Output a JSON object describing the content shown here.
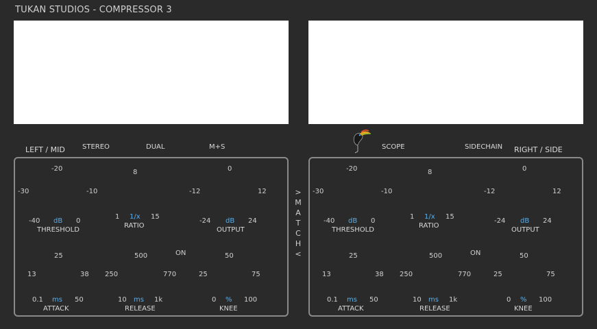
{
  "title": "TUKAN STUDIOS  -  COMPRESSOR 3",
  "modes": {
    "stereo": "STEREO",
    "dual": "DUAL",
    "ms": "M+S",
    "scope": "SCOPE",
    "sidechain": "SIDECHAIN"
  },
  "channels": {
    "left": "LEFT / MID",
    "right": "RIGHT / SIDE"
  },
  "match": [
    "&gt;",
    "M",
    "A",
    "T",
    "C",
    "H",
    "&lt;"
  ],
  "match_chars": [
    ">",
    "M",
    "A",
    "T",
    "C",
    "H",
    "<"
  ],
  "logo_icon": "toucan-logo-icon",
  "panel": {
    "threshold": {
      "label": "THRESHOLD",
      "unit": "dB",
      "min": "-40",
      "max": "0",
      "t1": "-30",
      "t2": "-20",
      "t3": "-10"
    },
    "ratio": {
      "label": "RATIO",
      "unit": "1/x",
      "min": "1",
      "max": "15",
      "t1": "8"
    },
    "output": {
      "label": "OUTPUT",
      "unit": "dB",
      "min": "-24",
      "max": "24",
      "t1": "-12",
      "t2": "0",
      "t3": "12"
    },
    "attack": {
      "label": "ATTACK",
      "unit": "ms",
      "min": "0.1",
      "max": "50",
      "t1": "13",
      "t2": "25",
      "t3": "38"
    },
    "release": {
      "label": "RELEASE",
      "unit": "ms",
      "min": "10",
      "max": "1k",
      "t1": "250",
      "t2": "500",
      "t3": "770"
    },
    "knee": {
      "label": "KNEE",
      "unit": "%",
      "min": "0",
      "max": "100",
      "t1": "25",
      "t2": "50",
      "t3": "75",
      "on": "ON"
    }
  },
  "colors": {
    "accent": "#5aaeea",
    "background": "#2a2a2a",
    "panel_border": "#8a8a8a",
    "display": "#ffffff"
  }
}
